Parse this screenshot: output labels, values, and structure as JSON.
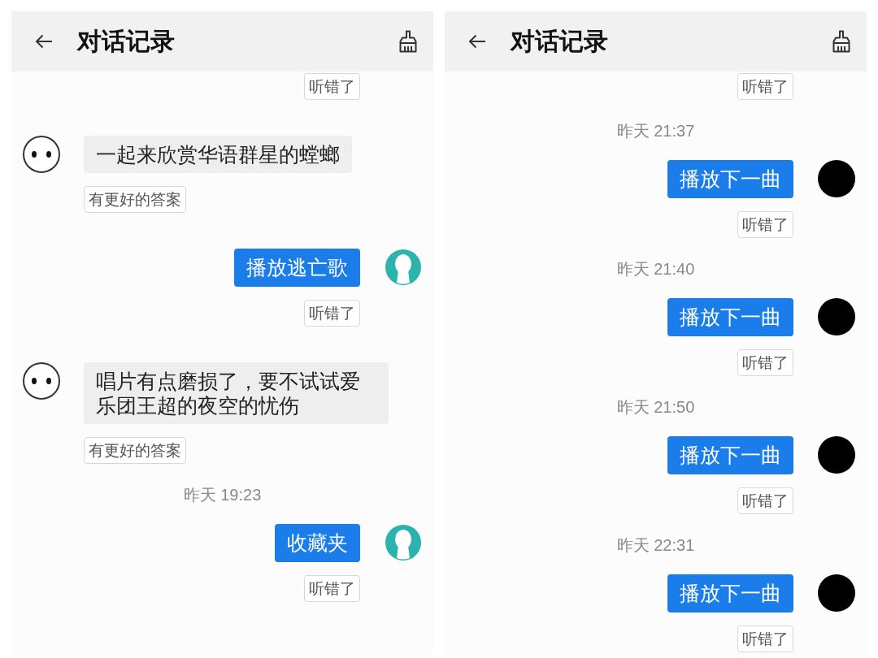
{
  "panels": [
    {
      "header": {
        "title": "对话记录"
      },
      "items": [
        {
          "kind": "user",
          "feedback": "听错了"
        },
        {
          "kind": "bot",
          "text": "一起来欣赏华语群星的螳螂",
          "feedback": "有更好的答案"
        },
        {
          "kind": "user",
          "text": "播放逃亡歌",
          "feedback": "听错了"
        },
        {
          "kind": "bot",
          "text": "唱片有点磨损了，要不试试爱乐团王超的夜空的忧伤",
          "feedback": "有更好的答案"
        },
        {
          "kind": "time",
          "text": "昨天 19:23"
        },
        {
          "kind": "user",
          "text": "收藏夹",
          "feedback": "听错了"
        }
      ]
    },
    {
      "header": {
        "title": "对话记录"
      },
      "items": [
        {
          "kind": "user",
          "feedback": "听错了"
        },
        {
          "kind": "time",
          "text": "昨天 21:37"
        },
        {
          "kind": "user",
          "text": "播放下一曲",
          "feedback": "听错了"
        },
        {
          "kind": "time",
          "text": "昨天 21:40"
        },
        {
          "kind": "user",
          "text": "播放下一曲",
          "feedback": "听错了"
        },
        {
          "kind": "time",
          "text": "昨天 21:50"
        },
        {
          "kind": "user",
          "text": "播放下一曲",
          "feedback": "听错了"
        },
        {
          "kind": "time",
          "text": "昨天 22:31"
        },
        {
          "kind": "user",
          "text": "播放下一曲",
          "feedback": "听错了"
        }
      ]
    }
  ]
}
